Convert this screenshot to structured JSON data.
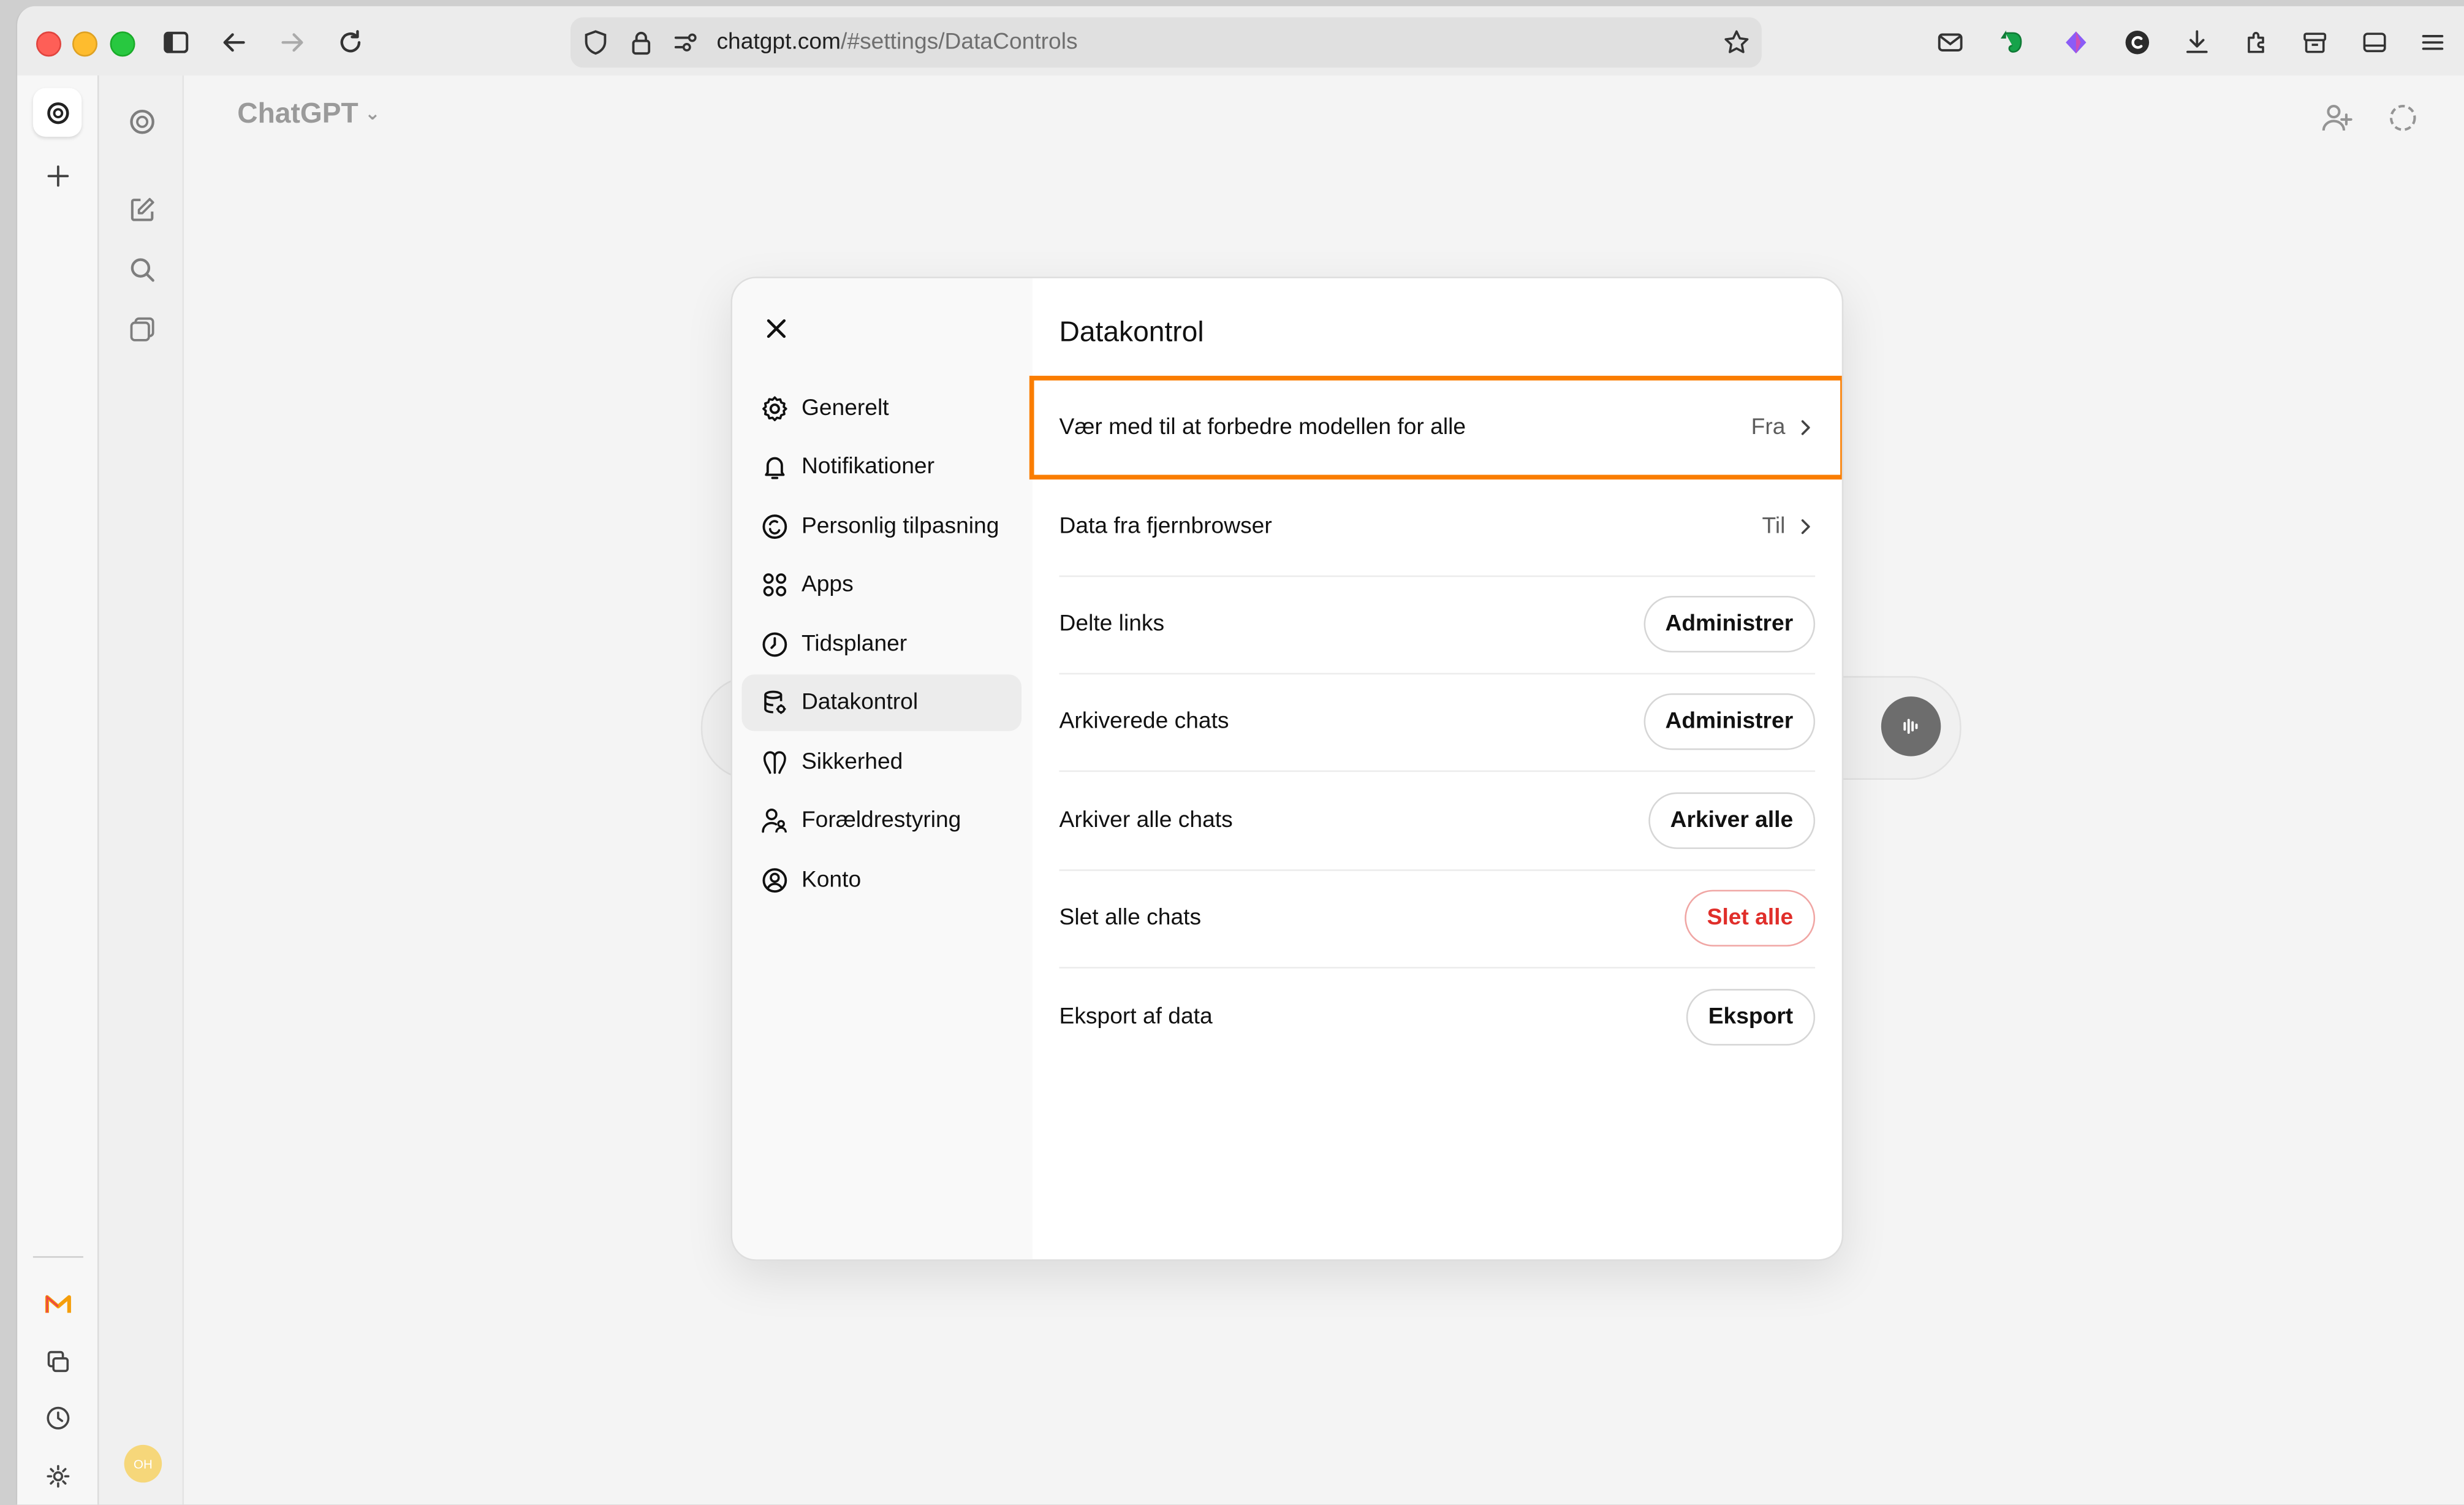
{
  "browser": {
    "url_host": "chatgpt.com",
    "url_path": "/#settings/DataControls"
  },
  "app": {
    "title": "ChatGPT",
    "avatar_initials": "OH"
  },
  "settings": {
    "title": "Datakontrol",
    "nav": [
      {
        "label": "Generelt",
        "icon": "gear-icon"
      },
      {
        "label": "Notifikationer",
        "icon": "bell-icon"
      },
      {
        "label": "Personlig tilpasning",
        "icon": "personalize-icon"
      },
      {
        "label": "Apps",
        "icon": "apps-grid-icon"
      },
      {
        "label": "Tidsplaner",
        "icon": "clock-icon"
      },
      {
        "label": "Datakontrol",
        "icon": "database-icon",
        "active": true
      },
      {
        "label": "Sikkerhed",
        "icon": "security-icon"
      },
      {
        "label": "Forældrestyring",
        "icon": "parental-icon"
      },
      {
        "label": "Konto",
        "icon": "account-icon"
      }
    ],
    "rows": [
      {
        "label": "Vær med til at forbedre modellen for alle",
        "value": "Fra",
        "highlighted": true
      },
      {
        "label": "Data fra fjernbrowser",
        "value": "Til"
      },
      {
        "label": "Delte links",
        "button": "Administrer"
      },
      {
        "label": "Arkiverede chats",
        "button": "Administrer"
      },
      {
        "label": "Arkiver alle chats",
        "button": "Arkiver alle"
      },
      {
        "label": "Slet alle chats",
        "button": "Slet alle",
        "danger": true
      },
      {
        "label": "Eksport af data",
        "button": "Eksport"
      }
    ]
  },
  "colors": {
    "highlight": "#fa7d00",
    "danger": "#e02e2a"
  }
}
